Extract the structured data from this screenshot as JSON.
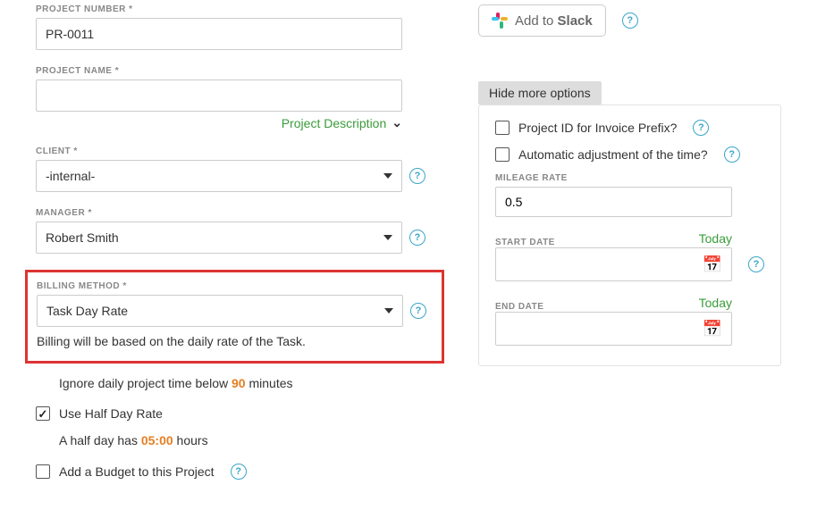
{
  "left": {
    "project_number_label": "PROJECT NUMBER *",
    "project_number_value": "PR-0011",
    "project_name_label": "PROJECT NAME *",
    "project_name_value": "",
    "project_description_link": "Project Description",
    "client_label": "CLIENT *",
    "client_value": "-internal-",
    "manager_label": "MANAGER *",
    "manager_value": "Robert Smith",
    "billing_method_label": "BILLING METHOD *",
    "billing_method_value": "Task Day Rate",
    "billing_hint": "Billing will be based on the daily rate of the Task.",
    "ignore_below_prefix": "Ignore daily project time below ",
    "ignore_below_value": "90",
    "ignore_below_suffix": " minutes",
    "half_day_label": "Use Half Day Rate",
    "half_day_prefix": "A half day has ",
    "half_day_value": "05:00",
    "half_day_suffix": " hours",
    "add_budget_label": "Add a Budget to this Project"
  },
  "right": {
    "slack_text": "Add to Slack",
    "hide_options": "Hide more options",
    "invoice_prefix_label": "Project ID for Invoice Prefix?",
    "auto_adjust_label": "Automatic adjustment of the time?",
    "mileage_label": "MILEAGE RATE",
    "mileage_value": "0.5",
    "start_date_label": "START DATE",
    "end_date_label": "END DATE",
    "today_label": "Today"
  }
}
